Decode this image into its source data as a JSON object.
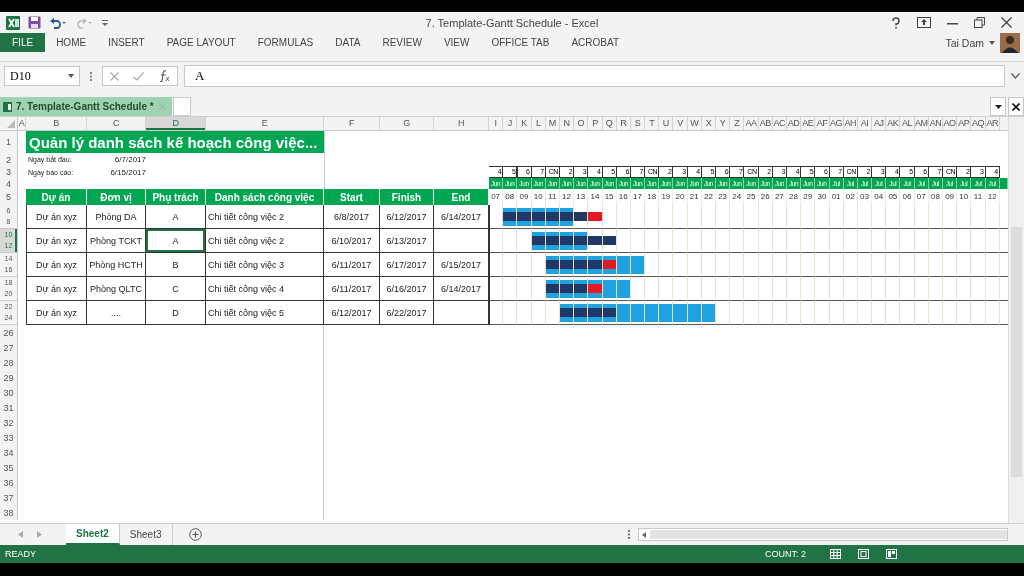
{
  "title_bar": {
    "title": "7. Template-Gantt Schedule - Excel"
  },
  "ribbon": {
    "tabs": [
      {
        "label": "FILE",
        "selected": true
      },
      {
        "label": "HOME",
        "selected": false
      },
      {
        "label": "INSERT",
        "selected": false
      },
      {
        "label": "PAGE LAYOUT",
        "selected": false
      },
      {
        "label": "FORMULAS",
        "selected": false
      },
      {
        "label": "DATA",
        "selected": false
      },
      {
        "label": "REVIEW",
        "selected": false
      },
      {
        "label": "VIEW",
        "selected": false
      },
      {
        "label": "OFFICE TAB",
        "selected": false
      },
      {
        "label": "ACROBAT",
        "selected": false
      }
    ],
    "user": "Tai Dam"
  },
  "formula_bar": {
    "name_box": "D10",
    "formula": "A"
  },
  "document_tab": {
    "title": "7. Template-Gantt Schedule *"
  },
  "columns": [
    {
      "letter": "A",
      "selected": false
    },
    {
      "letter": "B",
      "selected": false
    },
    {
      "letter": "C",
      "selected": false
    },
    {
      "letter": "D",
      "selected": true
    },
    {
      "letter": "E",
      "selected": false
    },
    {
      "letter": "F",
      "selected": false
    },
    {
      "letter": "G",
      "selected": false
    },
    {
      "letter": "H",
      "selected": false
    }
  ],
  "timeline": [
    {
      "letter": "I",
      "weekday": "4",
      "month": "Jun",
      "day": "07"
    },
    {
      "letter": "J",
      "weekday": "5",
      "month": "Jun",
      "day": "08"
    },
    {
      "letter": "K",
      "weekday": "6",
      "month": "Jun",
      "day": "09"
    },
    {
      "letter": "L",
      "weekday": "7",
      "month": "Jun",
      "day": "10"
    },
    {
      "letter": "M",
      "weekday": "CN",
      "month": "Jun",
      "day": "11"
    },
    {
      "letter": "N",
      "weekday": "2",
      "month": "Jun",
      "day": "12"
    },
    {
      "letter": "O",
      "weekday": "3",
      "month": "Jun",
      "day": "13"
    },
    {
      "letter": "P",
      "weekday": "4",
      "month": "Jun",
      "day": "14"
    },
    {
      "letter": "Q",
      "weekday": "5",
      "month": "Jun",
      "day": "15"
    },
    {
      "letter": "R",
      "weekday": "6",
      "month": "Jun",
      "day": "16"
    },
    {
      "letter": "S",
      "weekday": "7",
      "month": "Jun",
      "day": "17"
    },
    {
      "letter": "T",
      "weekday": "CN",
      "month": "Jun",
      "day": "18"
    },
    {
      "letter": "U",
      "weekday": "2",
      "month": "Jun",
      "day": "19"
    },
    {
      "letter": "V",
      "weekday": "3",
      "month": "Jun",
      "day": "20"
    },
    {
      "letter": "W",
      "weekday": "4",
      "month": "Jun",
      "day": "21"
    },
    {
      "letter": "X",
      "weekday": "5",
      "month": "Jun",
      "day": "22"
    },
    {
      "letter": "Y",
      "weekday": "6",
      "month": "Jun",
      "day": "23"
    },
    {
      "letter": "Z",
      "weekday": "7",
      "month": "Jun",
      "day": "24"
    },
    {
      "letter": "AA",
      "weekday": "CN",
      "month": "Jun",
      "day": "25"
    },
    {
      "letter": "AB",
      "weekday": "2",
      "month": "Jun",
      "day": "26"
    },
    {
      "letter": "AC",
      "weekday": "3",
      "month": "Jun",
      "day": "27"
    },
    {
      "letter": "AD",
      "weekday": "4",
      "month": "Jun",
      "day": "28"
    },
    {
      "letter": "AE",
      "weekday": "5",
      "month": "Jun",
      "day": "29"
    },
    {
      "letter": "AF",
      "weekday": "6",
      "month": "Jun",
      "day": "30"
    },
    {
      "letter": "AG",
      "weekday": "7",
      "month": "Jul",
      "day": "01"
    },
    {
      "letter": "AH",
      "weekday": "CN",
      "month": "Jul",
      "day": "02"
    },
    {
      "letter": "AI",
      "weekday": "2",
      "month": "Jul",
      "day": "03"
    },
    {
      "letter": "AJ",
      "weekday": "3",
      "month": "Jul",
      "day": "04"
    },
    {
      "letter": "AK",
      "weekday": "4",
      "month": "Jul",
      "day": "05"
    },
    {
      "letter": "AL",
      "weekday": "5",
      "month": "Jul",
      "day": "06"
    },
    {
      "letter": "AM",
      "weekday": "6",
      "month": "Jul",
      "day": "07"
    },
    {
      "letter": "AN",
      "weekday": "7",
      "month": "Jul",
      "day": "08"
    },
    {
      "letter": "AO",
      "weekday": "CN",
      "month": "Jul",
      "day": "09"
    },
    {
      "letter": "AP",
      "weekday": "2",
      "month": "Jul",
      "day": "10"
    },
    {
      "letter": "AQ",
      "weekday": "3",
      "month": "Jul",
      "day": "11"
    },
    {
      "letter": "AR",
      "weekday": "4",
      "month": "Jul",
      "day": "12"
    }
  ],
  "sheet": {
    "title": "Quản lý danh sách kế hoạch công việc...",
    "start_label": "Ngày bắt đầu:",
    "start_value": "6/7/2017",
    "report_label": "Ngày báo cáo:",
    "report_value": "6/15/2017",
    "headers": [
      "Dự án",
      "Đơn vị",
      "Phụ trách",
      "Danh sách công việc",
      "Start",
      "Finish",
      "End"
    ],
    "rows": [
      {
        "row_headers": [
          "6",
          "8"
        ],
        "selected": false,
        "project": "Dự án xyz",
        "unit": "Phòng DA",
        "owner": "A",
        "task": "Chi tiết công việc 2",
        "start": "6/8/2017",
        "finish": "6/12/2017",
        "end": "6/14/2017",
        "gantt": [
          {
            "planned": false,
            "actual": false,
            "late": false
          },
          {
            "planned": true,
            "actual": true,
            "late": false
          },
          {
            "planned": true,
            "actual": true,
            "late": false
          },
          {
            "planned": true,
            "actual": true,
            "late": false
          },
          {
            "planned": true,
            "actual": true,
            "late": false
          },
          {
            "planned": true,
            "actual": true,
            "late": false
          },
          {
            "planned": false,
            "actual": true,
            "late": false
          },
          {
            "planned": false,
            "actual": false,
            "late": true
          }
        ]
      },
      {
        "row_headers": [
          "10",
          "12"
        ],
        "selected": true,
        "project": "Dự án xyz",
        "unit": "Phòng TCKT",
        "owner": "A",
        "task": "Chi tiết công việc 2",
        "start": "6/10/2017",
        "finish": "6/13/2017",
        "gantt": [
          {
            "planned": false,
            "actual": false,
            "late": false
          },
          {
            "planned": false,
            "actual": false,
            "late": false
          },
          {
            "planned": false,
            "actual": false,
            "late": false
          },
          {
            "planned": true,
            "actual": true,
            "late": false
          },
          {
            "planned": true,
            "actual": true,
            "late": false
          },
          {
            "planned": true,
            "actual": true,
            "late": false
          },
          {
            "planned": true,
            "actual": true,
            "late": false
          },
          {
            "planned": false,
            "actual": true,
            "late": false
          },
          {
            "planned": false,
            "actual": true,
            "late": false
          }
        ]
      },
      {
        "row_headers": [
          "14",
          "16"
        ],
        "selected": false,
        "project": "Dự án xyz",
        "unit": "Phòng HCTH",
        "owner": "B",
        "task": "Chi tiết công việc 3",
        "start": "6/11/2017",
        "finish": "6/17/2017",
        "end": "6/15/2017",
        "gantt": [
          {
            "planned": false,
            "actual": false,
            "late": false
          },
          {
            "planned": false,
            "actual": false,
            "late": false
          },
          {
            "planned": false,
            "actual": false,
            "late": false
          },
          {
            "planned": false,
            "actual": false,
            "late": false
          },
          {
            "planned": true,
            "actual": true,
            "late": false
          },
          {
            "planned": true,
            "actual": true,
            "late": false
          },
          {
            "planned": true,
            "actual": true,
            "late": false
          },
          {
            "planned": true,
            "actual": true,
            "late": false
          },
          {
            "planned": true,
            "actual": false,
            "late": true
          },
          {
            "planned": true,
            "actual": false,
            "late": false
          },
          {
            "planned": true,
            "actual": false,
            "late": false
          }
        ]
      },
      {
        "row_headers": [
          "18",
          "20"
        ],
        "selected": false,
        "project": "Dự án xyz",
        "unit": "Phòng QLTC",
        "owner": "C",
        "task": "Chi tiết công việc 4",
        "start": "6/11/2017",
        "finish": "6/16/2017",
        "end": "6/14/2017",
        "gantt": [
          {
            "planned": false,
            "actual": false,
            "late": false
          },
          {
            "planned": false,
            "actual": false,
            "late": false
          },
          {
            "planned": false,
            "actual": false,
            "late": false
          },
          {
            "planned": false,
            "actual": false,
            "late": false
          },
          {
            "planned": true,
            "actual": true,
            "late": false
          },
          {
            "planned": true,
            "actual": true,
            "late": false
          },
          {
            "planned": true,
            "actual": true,
            "late": false
          },
          {
            "planned": true,
            "actual": false,
            "late": true
          },
          {
            "planned": true,
            "actual": false,
            "late": false
          },
          {
            "planned": true,
            "actual": false,
            "late": false
          }
        ]
      },
      {
        "row_headers": [
          "22",
          "24"
        ],
        "selected": false,
        "project": "Dự án xyz",
        "unit": "....",
        "owner": "D",
        "task": "Chi tiết công việc 5",
        "start": "6/12/2017",
        "finish": "6/22/2017",
        "gantt": [
          {
            "planned": false,
            "actual": false,
            "late": false
          },
          {
            "planned": false,
            "actual": false,
            "late": false
          },
          {
            "planned": false,
            "actual": false,
            "late": false
          },
          {
            "planned": false,
            "actual": false,
            "late": false
          },
          {
            "planned": false,
            "actual": false,
            "late": false
          },
          {
            "planned": true,
            "actual": true,
            "late": false
          },
          {
            "planned": true,
            "actual": true,
            "late": false
          },
          {
            "planned": true,
            "actual": true,
            "late": false
          },
          {
            "planned": true,
            "actual": true,
            "late": false
          },
          {
            "planned": true,
            "actual": false,
            "late": false
          },
          {
            "planned": true,
            "actual": false,
            "late": false
          },
          {
            "planned": true,
            "actual": false,
            "late": false
          },
          {
            "planned": true,
            "actual": false,
            "late": false
          },
          {
            "planned": true,
            "actual": false,
            "late": false
          },
          {
            "planned": true,
            "actual": false,
            "late": false
          },
          {
            "planned": true,
            "actual": false,
            "late": false
          }
        ]
      }
    ],
    "fixed_row_headers": [
      "1",
      "2",
      "3",
      "4",
      "5"
    ],
    "empty_rows": [
      "26",
      "27",
      "28",
      "29",
      "30",
      "31",
      "32",
      "33",
      "34",
      "35",
      "36",
      "37",
      "38"
    ]
  },
  "sheet_tabs": [
    {
      "label": "Sheet2",
      "selected": true
    },
    {
      "label": "Sheet3",
      "selected": false
    }
  ],
  "status_bar": {
    "mode": "READY",
    "count": "COUNT: 2"
  }
}
